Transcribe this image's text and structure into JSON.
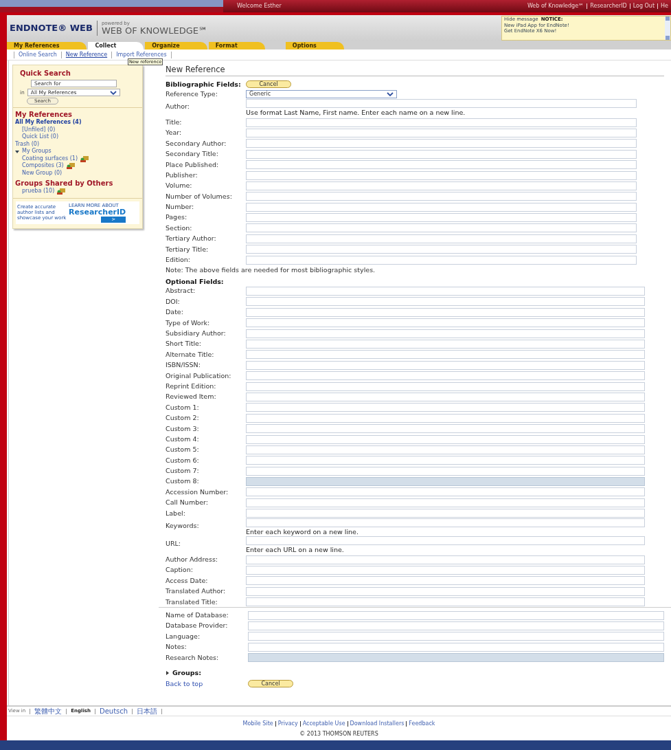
{
  "top_bar": {
    "welcome": "Welcome Esther",
    "links": [
      "Web of Knowledge℠",
      "ResearcherID",
      "Log Out",
      "He"
    ]
  },
  "header": {
    "powered_by": "powered by",
    "logo": "ENDNOTE® WEB",
    "partner": "WEB OF KNOWLEDGE℠",
    "notice": {
      "hide": "Hide message",
      "title": "NOTICE:",
      "lines": [
        "New iPad App for EndNote!",
        "Get EndNote X6 Now!"
      ]
    }
  },
  "tabs": [
    {
      "label": "My References",
      "selected": false
    },
    {
      "label": "Collect",
      "selected": true
    },
    {
      "label": "Organize",
      "selected": false
    },
    {
      "label": "Format",
      "selected": false
    },
    {
      "label": "Options",
      "selected": false
    }
  ],
  "subnav": [
    {
      "label": "Online Search",
      "selected": false
    },
    {
      "label": "New Reference",
      "selected": true
    },
    {
      "label": "Import References",
      "selected": false
    }
  ],
  "tooltip": "New reference",
  "sidebar": {
    "quick_search": {
      "title": "Quick Search",
      "field_value": "Search for",
      "in_label": "in",
      "scope": "All My References",
      "button": "Search"
    },
    "my_references": {
      "title": "My References",
      "items": [
        {
          "label": "All My References (4)",
          "shared": false,
          "children": [
            {
              "label": "[Unfiled] (0)",
              "shared": false
            },
            {
              "label": "Quick List (0)",
              "shared": false
            }
          ]
        },
        {
          "label": "Trash (0)",
          "shared": false
        },
        {
          "label": "My Groups",
          "expanded": true,
          "shared": false,
          "children": [
            {
              "label": "Coating surfaces (1)",
              "shared": true
            },
            {
              "label": "Composites (3)",
              "shared": true
            },
            {
              "label": "New Group (0)",
              "shared": false
            }
          ]
        }
      ]
    },
    "shared_groups": {
      "title": "Groups Shared by Others",
      "items": [
        {
          "label": "prueba (10)",
          "shared": true
        }
      ]
    },
    "ad": {
      "text": "Create accurate author lists and showcase your work",
      "learn": "LEARN MORE ABOUT",
      "brand": "ResearcherID",
      "button": ">"
    }
  },
  "form": {
    "title": "New Reference",
    "bibliographic": {
      "heading": "Bibliographic Fields:",
      "cancel": "Cancel",
      "fields": [
        {
          "label": "Reference Type:",
          "kind": "select",
          "value": "Generic"
        },
        {
          "label": "Author:",
          "kind": "text",
          "hint": "Use format Last Name, First name. Enter each name on a new line.",
          "disabled": false
        },
        {
          "label": "Title:",
          "kind": "text",
          "disabled": false
        },
        {
          "label": "Year:",
          "kind": "text",
          "disabled": false
        },
        {
          "label": "Secondary Author:",
          "kind": "text",
          "disabled": false
        },
        {
          "label": "Secondary Title:",
          "kind": "text",
          "disabled": false
        },
        {
          "label": "Place Published:",
          "kind": "text",
          "disabled": false
        },
        {
          "label": "Publisher:",
          "kind": "text",
          "disabled": false
        },
        {
          "label": "Volume:",
          "kind": "text",
          "disabled": false
        },
        {
          "label": "Number of Volumes:",
          "kind": "text",
          "disabled": false
        },
        {
          "label": "Number:",
          "kind": "text",
          "disabled": false
        },
        {
          "label": "Pages:",
          "kind": "text",
          "disabled": false
        },
        {
          "label": "Section:",
          "kind": "text",
          "disabled": false
        },
        {
          "label": "Tertiary Author:",
          "kind": "text",
          "disabled": false
        },
        {
          "label": "Tertiary Title:",
          "kind": "text",
          "disabled": false
        },
        {
          "label": "Edition:",
          "kind": "text",
          "disabled": false
        }
      ],
      "note": "Note: The above fields are needed for most bibliographic styles."
    },
    "optional": {
      "heading": "Optional Fields:",
      "fields": [
        {
          "label": "Abstract:",
          "kind": "text",
          "disabled": false
        },
        {
          "label": "DOI:",
          "kind": "text",
          "disabled": false
        },
        {
          "label": "Date:",
          "kind": "text",
          "disabled": false
        },
        {
          "label": "Type of Work:",
          "kind": "text",
          "disabled": false
        },
        {
          "label": "Subsidiary Author:",
          "kind": "text",
          "disabled": false
        },
        {
          "label": "Short Title:",
          "kind": "text",
          "disabled": false
        },
        {
          "label": "Alternate Title:",
          "kind": "text",
          "disabled": false
        },
        {
          "label": "ISBN/ISSN:",
          "kind": "text",
          "disabled": false
        },
        {
          "label": "Original Publication:",
          "kind": "text",
          "disabled": false
        },
        {
          "label": "Reprint Edition:",
          "kind": "text",
          "disabled": false
        },
        {
          "label": "Reviewed Item:",
          "kind": "text",
          "disabled": false
        },
        {
          "label": "Custom 1:",
          "kind": "text",
          "disabled": false
        },
        {
          "label": "Custom 2:",
          "kind": "text",
          "disabled": false
        },
        {
          "label": "Custom 3:",
          "kind": "text",
          "disabled": false
        },
        {
          "label": "Custom 4:",
          "kind": "text",
          "disabled": false
        },
        {
          "label": "Custom 5:",
          "kind": "text",
          "disabled": false
        },
        {
          "label": "Custom 6:",
          "kind": "text",
          "disabled": false
        },
        {
          "label": "Custom 7:",
          "kind": "text",
          "disabled": false
        },
        {
          "label": "Custom 8:",
          "kind": "text",
          "disabled": true
        },
        {
          "label": "Accession Number:",
          "kind": "text",
          "disabled": false
        },
        {
          "label": "Call Number:",
          "kind": "text",
          "disabled": false
        },
        {
          "label": "Label:",
          "kind": "text",
          "disabled": false
        },
        {
          "label": "Keywords:",
          "kind": "text",
          "hint": "Enter each keyword on a new line.",
          "disabled": false
        },
        {
          "label": "URL:",
          "kind": "text",
          "hint": "Enter each URL on a new line.",
          "disabled": false
        },
        {
          "label": "Author Address:",
          "kind": "text",
          "disabled": false
        },
        {
          "label": "Caption:",
          "kind": "text",
          "disabled": false
        },
        {
          "label": "Access Date:",
          "kind": "text",
          "disabled": false
        },
        {
          "label": "Translated Author:",
          "kind": "text",
          "disabled": false
        },
        {
          "label": "Translated Title:",
          "kind": "text",
          "disabled": false
        }
      ]
    },
    "extra": {
      "fields": [
        {
          "label": "Name of Database:",
          "kind": "text",
          "disabled": false
        },
        {
          "label": "Database Provider:",
          "kind": "text",
          "disabled": false
        },
        {
          "label": "Language:",
          "kind": "text",
          "disabled": false
        },
        {
          "label": "Notes:",
          "kind": "text",
          "disabled": false
        },
        {
          "label": "Research Notes:",
          "kind": "text",
          "disabled": true
        }
      ]
    },
    "groups": {
      "label": "Groups:",
      "expanded": false
    },
    "back_to_top": "Back to top",
    "cancel": "Cancel"
  },
  "footer": {
    "view_in": "View in",
    "languages": [
      {
        "label": "繁體中文",
        "selected": false
      },
      {
        "label": "English",
        "selected": true
      },
      {
        "label": "Deutsch",
        "selected": false
      },
      {
        "label": "日本語",
        "selected": false
      }
    ],
    "links": [
      "Mobile Site",
      "Privacy",
      "Acceptable Use",
      "Download Installers",
      "Feedback"
    ],
    "copyright": "© 2013 THOMSON REUTERS"
  }
}
